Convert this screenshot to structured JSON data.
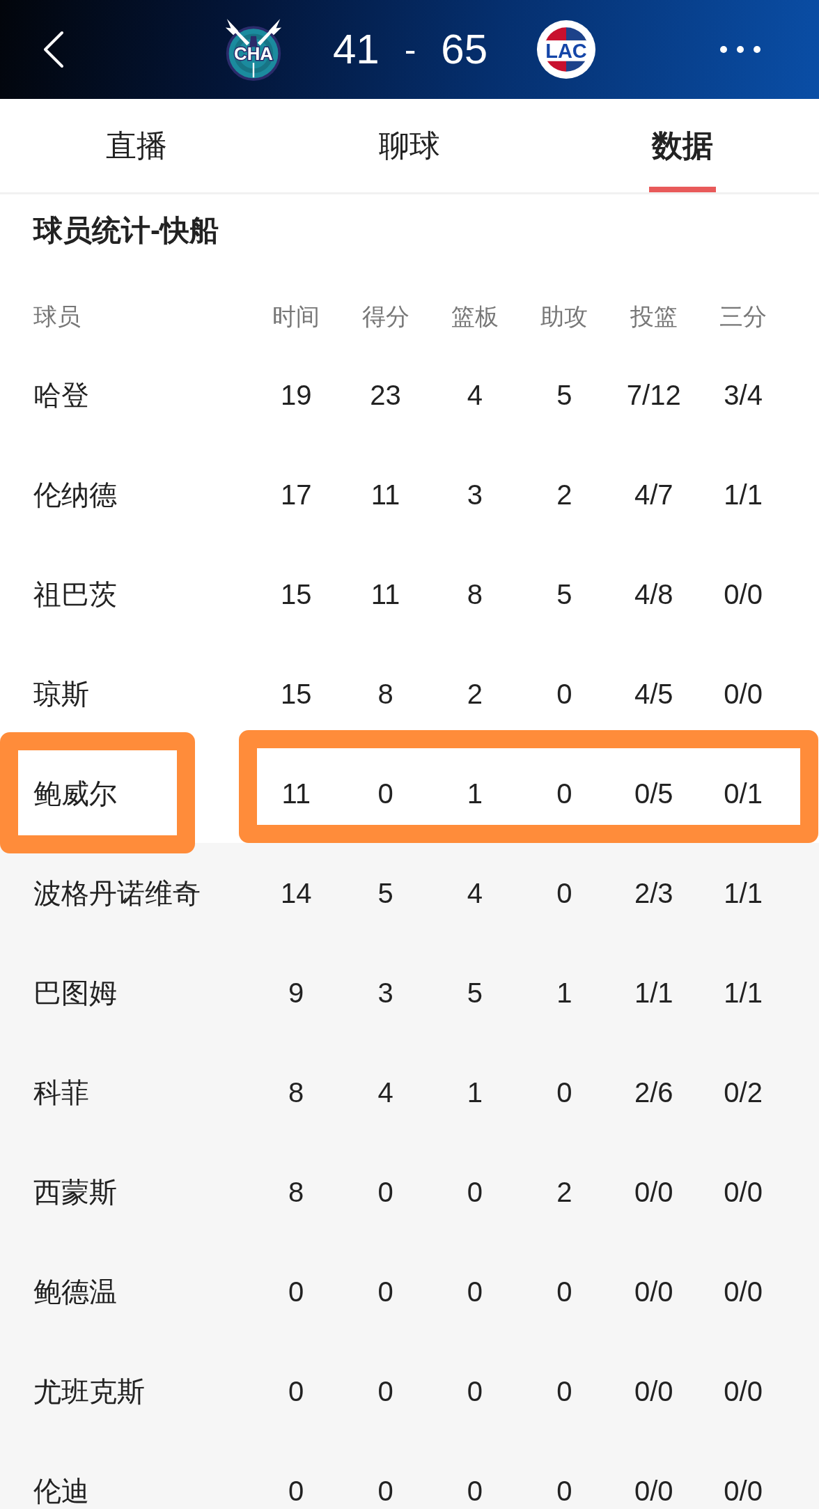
{
  "header": {
    "home_team": {
      "abbr": "CHA"
    },
    "score": {
      "home": "41",
      "separator": "-",
      "away": "65"
    },
    "away_team": {
      "abbr": "LAC"
    }
  },
  "tabs": [
    {
      "label": "直播",
      "selected": false
    },
    {
      "label": "聊球",
      "selected": false
    },
    {
      "label": "数据",
      "selected": true
    }
  ],
  "section_title": "球员统计-快船",
  "table": {
    "columns": [
      "球员",
      "时间",
      "得分",
      "篮板",
      "助攻",
      "投篮",
      "三分"
    ],
    "rows": [
      {
        "cells": [
          "哈登",
          "19",
          "23",
          "4",
          "5",
          "7/12",
          "3/4"
        ],
        "shaded": false,
        "highlighted": false
      },
      {
        "cells": [
          "伦纳德",
          "17",
          "11",
          "3",
          "2",
          "4/7",
          "1/1"
        ],
        "shaded": false,
        "highlighted": false
      },
      {
        "cells": [
          "祖巴茨",
          "15",
          "11",
          "8",
          "5",
          "4/8",
          "0/0"
        ],
        "shaded": false,
        "highlighted": false
      },
      {
        "cells": [
          "琼斯",
          "15",
          "8",
          "2",
          "0",
          "4/5",
          "0/0"
        ],
        "shaded": false,
        "highlighted": false
      },
      {
        "cells": [
          "鲍威尔",
          "11",
          "0",
          "1",
          "0",
          "0/5",
          "0/1"
        ],
        "shaded": false,
        "highlighted": true
      },
      {
        "cells": [
          "波格丹诺维奇",
          "14",
          "5",
          "4",
          "0",
          "2/3",
          "1/1"
        ],
        "shaded": true,
        "highlighted": false
      },
      {
        "cells": [
          "巴图姆",
          "9",
          "3",
          "5",
          "1",
          "1/1",
          "1/1"
        ],
        "shaded": true,
        "highlighted": false
      },
      {
        "cells": [
          "科菲",
          "8",
          "4",
          "1",
          "0",
          "2/6",
          "0/2"
        ],
        "shaded": true,
        "highlighted": false
      },
      {
        "cells": [
          "西蒙斯",
          "8",
          "0",
          "0",
          "2",
          "0/0",
          "0/0"
        ],
        "shaded": true,
        "highlighted": false
      },
      {
        "cells": [
          "鲍德温",
          "0",
          "0",
          "0",
          "0",
          "0/0",
          "0/0"
        ],
        "shaded": true,
        "highlighted": false
      },
      {
        "cells": [
          "尤班克斯",
          "0",
          "0",
          "0",
          "0",
          "0/0",
          "0/0"
        ],
        "shaded": true,
        "highlighted": false
      },
      {
        "cells": [
          "伦迪",
          "0",
          "0",
          "0",
          "0",
          "0/0",
          "0/0"
        ],
        "shaded": true,
        "highlighted": false
      }
    ]
  }
}
